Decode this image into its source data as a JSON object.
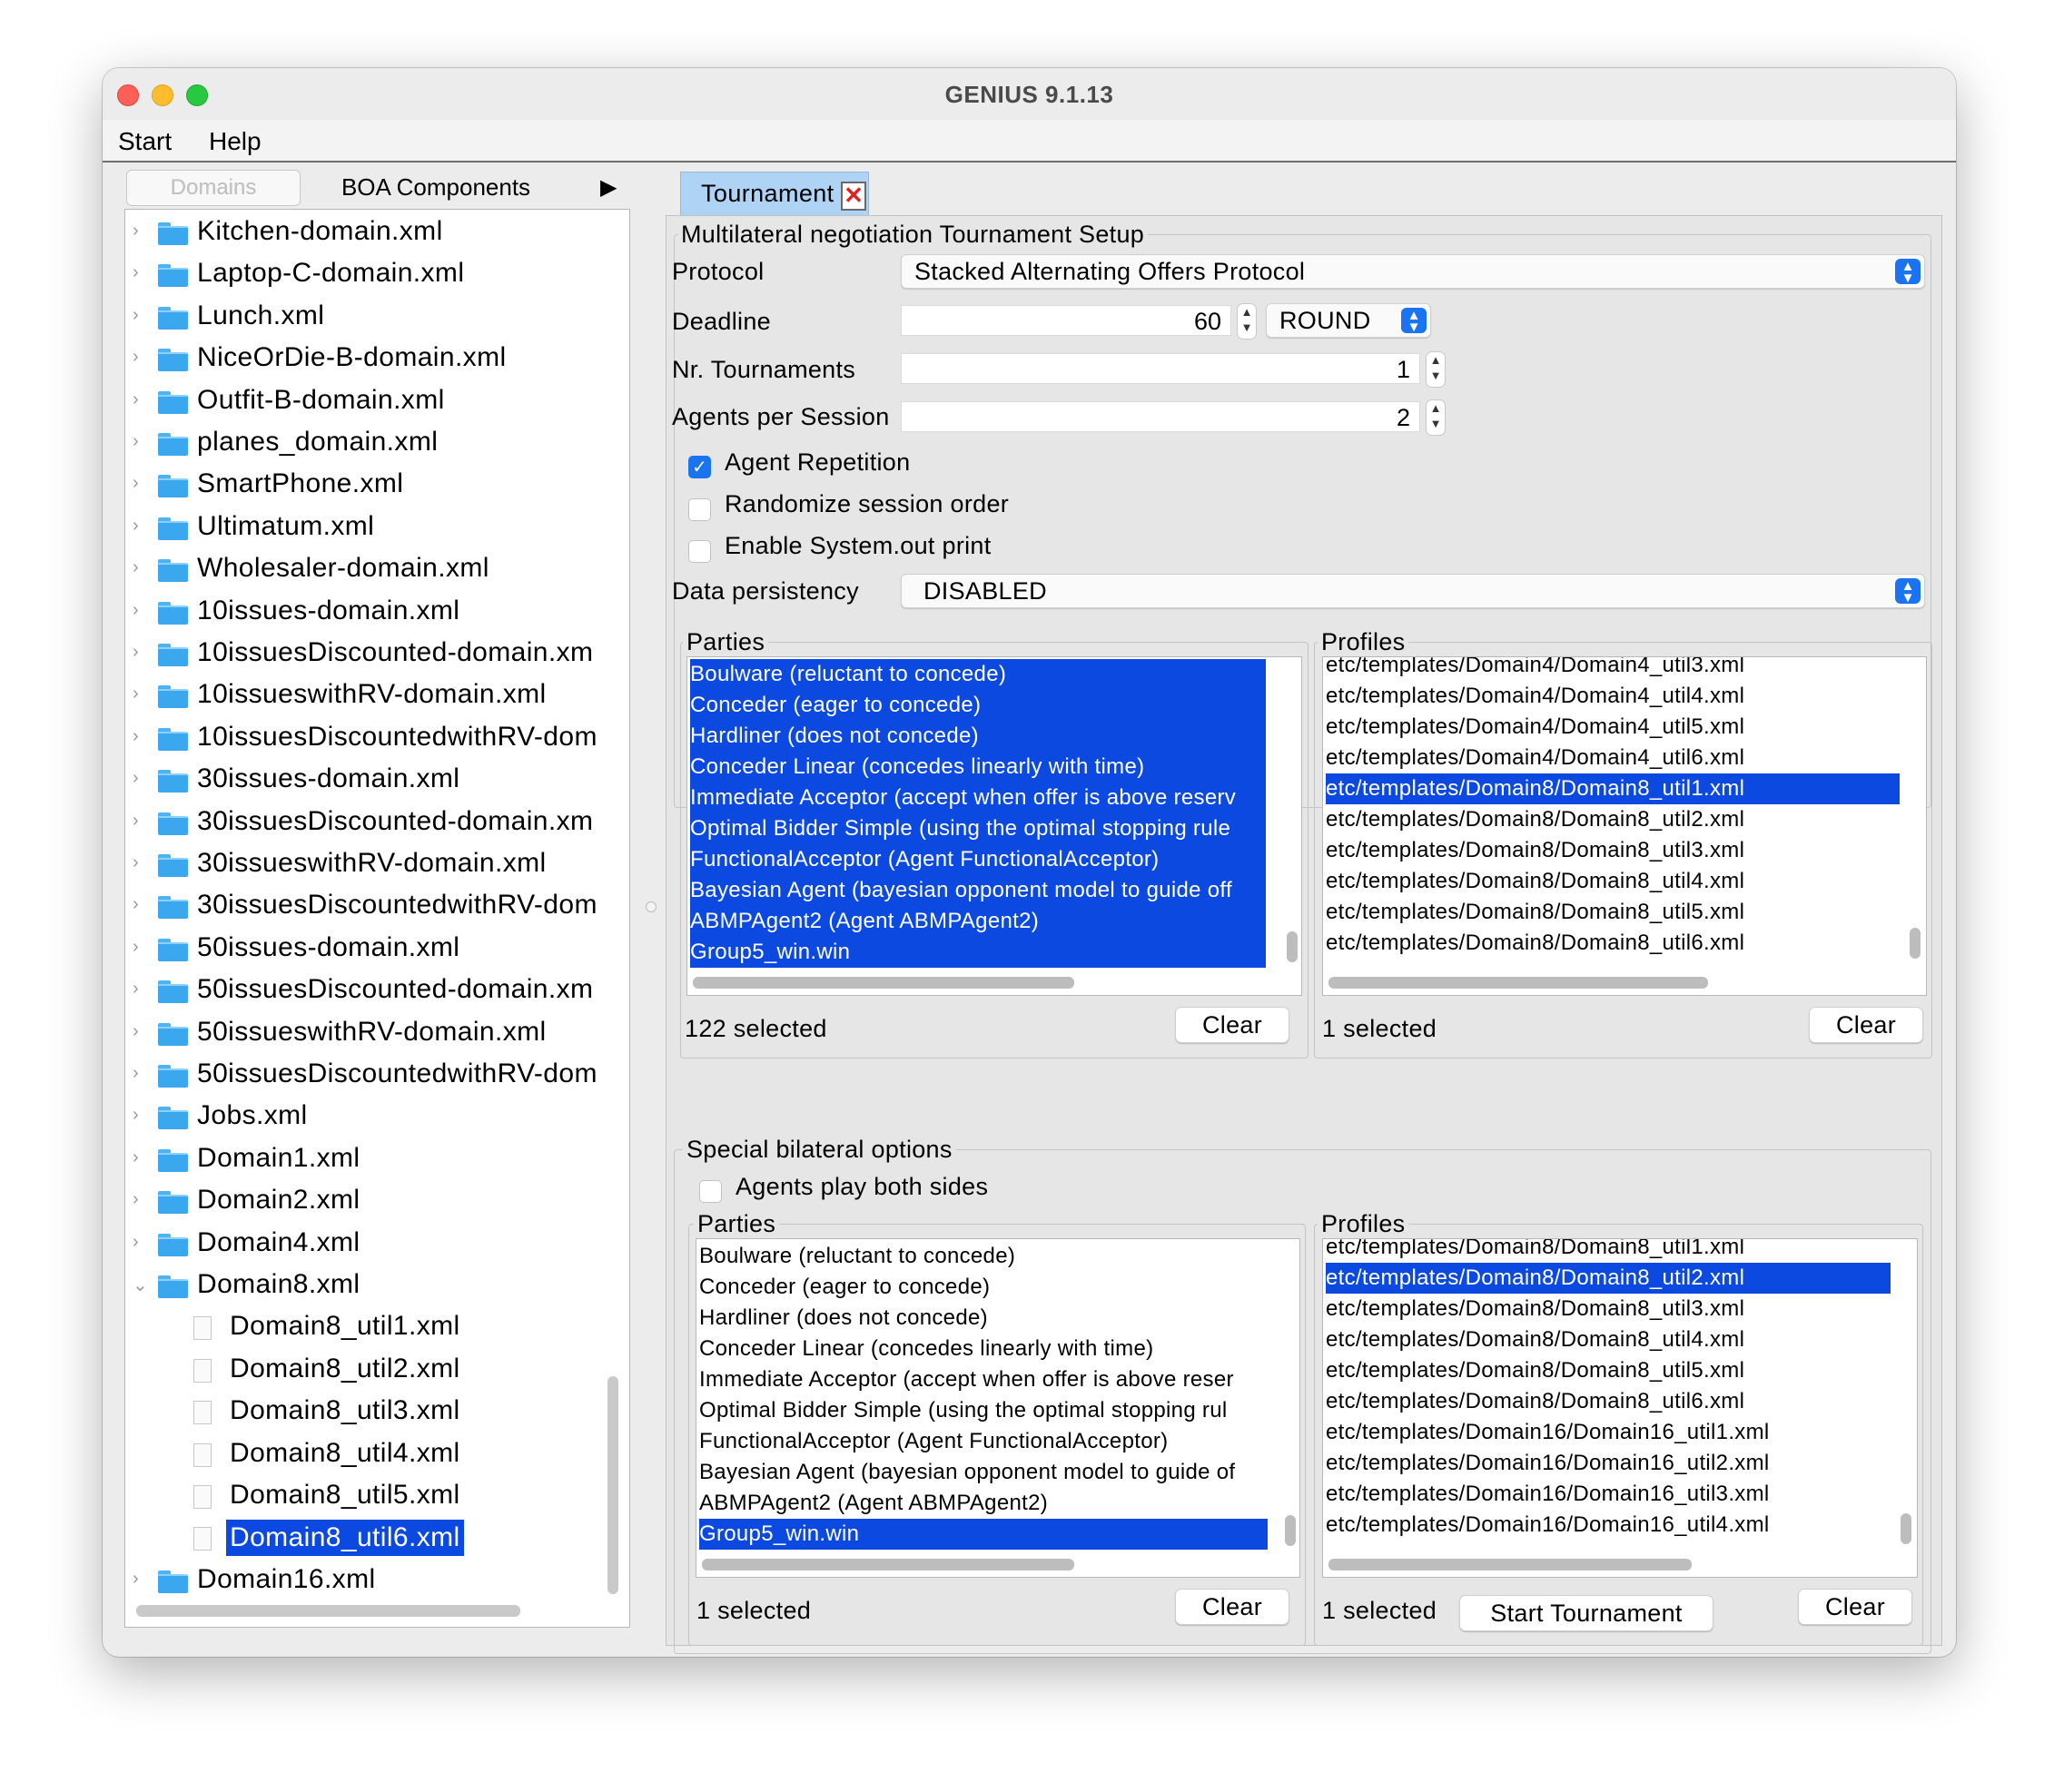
{
  "window": {
    "title": "GENIUS 9.1.13"
  },
  "menu": {
    "start": "Start",
    "help": "Help"
  },
  "left_tabs": {
    "domains": "Domains",
    "boa": "BOA Components",
    "more": "▶"
  },
  "tree": {
    "items": [
      {
        "label": "Kitchen-domain.xml"
      },
      {
        "label": "Laptop-C-domain.xml"
      },
      {
        "label": "Lunch.xml"
      },
      {
        "label": "NiceOrDie-B-domain.xml"
      },
      {
        "label": "Outfit-B-domain.xml"
      },
      {
        "label": "planes_domain.xml"
      },
      {
        "label": "SmartPhone.xml"
      },
      {
        "label": "Ultimatum.xml"
      },
      {
        "label": "Wholesaler-domain.xml"
      },
      {
        "label": "10issues-domain.xml"
      },
      {
        "label": "10issuesDiscounted-domain.xm"
      },
      {
        "label": "10issueswithRV-domain.xml"
      },
      {
        "label": "10issuesDiscountedwithRV-dom"
      },
      {
        "label": "30issues-domain.xml"
      },
      {
        "label": "30issuesDiscounted-domain.xm"
      },
      {
        "label": "30issueswithRV-domain.xml"
      },
      {
        "label": "30issuesDiscountedwithRV-dom"
      },
      {
        "label": "50issues-domain.xml"
      },
      {
        "label": "50issuesDiscounted-domain.xm"
      },
      {
        "label": "50issueswithRV-domain.xml"
      },
      {
        "label": "50issuesDiscountedwithRV-dom"
      },
      {
        "label": "Jobs.xml"
      },
      {
        "label": "Domain1.xml"
      },
      {
        "label": "Domain2.xml"
      },
      {
        "label": "Domain4.xml"
      },
      {
        "label": "Domain8.xml"
      },
      {
        "label": "Domain8_util1.xml"
      },
      {
        "label": "Domain8_util2.xml"
      },
      {
        "label": "Domain8_util3.xml"
      },
      {
        "label": "Domain8_util4.xml"
      },
      {
        "label": "Domain8_util5.xml"
      },
      {
        "label": "Domain8_util6.xml"
      },
      {
        "label": "Domain16.xml"
      }
    ]
  },
  "tournament_tab": {
    "label": "Tournament",
    "close": "✕"
  },
  "setup": {
    "group_title": "Multilateral negotiation Tournament Setup",
    "protocol_label": "Protocol",
    "protocol_value": "Stacked Alternating Offers Protocol",
    "deadline_label": "Deadline",
    "deadline_value": "60",
    "deadline_unit": "ROUND",
    "tournaments_label": "Nr. Tournaments",
    "tournaments_value": "1",
    "agents_label": "Agents per Session",
    "agents_value": "2",
    "agent_repetition": "Agent Repetition",
    "randomize": "Randomize session order",
    "sysout": "Enable System.out print",
    "persistency_label": "Data persistency",
    "persistency_value": "DISABLED"
  },
  "parties": {
    "title": "Parties",
    "items": [
      "Boulware (reluctant to concede)",
      "Conceder (eager to concede)",
      "Hardliner (does not concede)",
      "Conceder Linear (concedes linearly with time)",
      "Immediate Acceptor (accept when offer is above reserv",
      "Optimal Bidder Simple (using the optimal stopping rule",
      "FunctionalAcceptor (Agent FunctionalAcceptor)",
      "Bayesian Agent (bayesian opponent model to guide off",
      "ABMPAgent2 (Agent ABMPAgent2)",
      "Group5_win.win"
    ],
    "status": "122 selected",
    "clear": "Clear"
  },
  "profiles": {
    "title": "Profiles",
    "items": [
      "etc/templates/Domain4/Domain4_util3.xml",
      "etc/templates/Domain4/Domain4_util4.xml",
      "etc/templates/Domain4/Domain4_util5.xml",
      "etc/templates/Domain4/Domain4_util6.xml",
      "etc/templates/Domain8/Domain8_util1.xml",
      "etc/templates/Domain8/Domain8_util2.xml",
      "etc/templates/Domain8/Domain8_util3.xml",
      "etc/templates/Domain8/Domain8_util4.xml",
      "etc/templates/Domain8/Domain8_util5.xml",
      "etc/templates/Domain8/Domain8_util6.xml"
    ],
    "status": "1 selected",
    "clear": "Clear"
  },
  "bilateral": {
    "title": "Special bilateral options",
    "both_sides": "Agents play both sides",
    "parties_title": "Parties",
    "parties": [
      "Boulware (reluctant to concede)",
      "Conceder (eager to concede)",
      "Hardliner (does not concede)",
      "Conceder Linear (concedes linearly with time)",
      "Immediate Acceptor (accept when offer is above reser",
      "Optimal Bidder Simple (using the optimal stopping rul",
      "FunctionalAcceptor (Agent FunctionalAcceptor)",
      "Bayesian Agent (bayesian opponent model to guide of",
      "ABMPAgent2 (Agent ABMPAgent2)",
      "Group5_win.win"
    ],
    "parties_status": "1 selected",
    "parties_clear": "Clear",
    "profiles_title": "Profiles",
    "profiles": [
      "etc/templates/Domain8/Domain8_util1.xml",
      "etc/templates/Domain8/Domain8_util2.xml",
      "etc/templates/Domain8/Domain8_util3.xml",
      "etc/templates/Domain8/Domain8_util4.xml",
      "etc/templates/Domain8/Domain8_util5.xml",
      "etc/templates/Domain8/Domain8_util6.xml",
      "etc/templates/Domain16/Domain16_util1.xml",
      "etc/templates/Domain16/Domain16_util2.xml",
      "etc/templates/Domain16/Domain16_util3.xml",
      "etc/templates/Domain16/Domain16_util4.xml"
    ],
    "profiles_status": "1 selected",
    "profiles_clear": "Clear"
  },
  "start_button": "Start Tournament"
}
